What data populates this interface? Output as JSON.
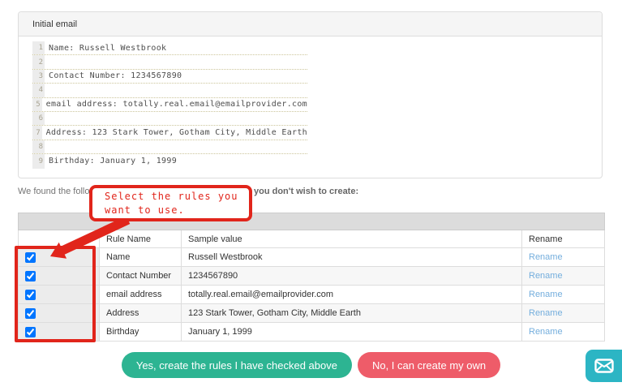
{
  "panel": {
    "title": "Initial email",
    "editor_lines": [
      {
        "num": "1",
        "text": "Name: Russell Westbrook"
      },
      {
        "num": "2",
        "text": ""
      },
      {
        "num": "3",
        "text": "Contact Number: 1234567890"
      },
      {
        "num": "4",
        "text": ""
      },
      {
        "num": "5",
        "text": "email address: totally.real.email@emailprovider.com"
      },
      {
        "num": "6",
        "text": ""
      },
      {
        "num": "7",
        "text": "Address: 123 Stark Tower, Gotham City, Middle Earth"
      },
      {
        "num": "8",
        "text": ""
      },
      {
        "num": "9",
        "text": "Birthday: January 1, 1999"
      }
    ]
  },
  "prompt": {
    "prefix": "We found the following",
    "suffix": "you don't wish to create:"
  },
  "rules_table": {
    "headers": {
      "rule_name": "Rule Name",
      "sample_value": "Sample value",
      "rename": "Rename"
    },
    "rows": [
      {
        "rule": "Name",
        "sample": "Russell Westbrook",
        "rename_label": "Rename",
        "checked": "checked"
      },
      {
        "rule": "Contact Number",
        "sample": "1234567890",
        "rename_label": "Rename",
        "checked": "checked"
      },
      {
        "rule": "email address",
        "sample": "totally.real.email@emailprovider.com",
        "rename_label": "Rename",
        "checked": "checked"
      },
      {
        "rule": "Address",
        "sample": "123 Stark Tower, Gotham City, Middle Earth",
        "rename_label": "Rename",
        "checked": "checked"
      },
      {
        "rule": "Birthday",
        "sample": "January 1, 1999",
        "rename_label": "Rename",
        "checked": "checked"
      }
    ]
  },
  "annotation": {
    "line1": "Select the rules you",
    "line2": "want to use."
  },
  "actions": {
    "yes_label": "Yes, create the rules I have checked above",
    "no_label": "No, I can create my own"
  },
  "icons": {
    "feedback": "envelope-icon"
  },
  "colors": {
    "button_green": "#2db492",
    "button_red": "#ee5c69",
    "feedback_teal": "#2cb5c4",
    "link_blue": "#74aedd",
    "annotation_red": "#e1251b",
    "panel_heading_bg": "#f5f5f5",
    "table_band_bg": "#dcdcdc",
    "editor_dotted_line": "#ccc59b"
  }
}
